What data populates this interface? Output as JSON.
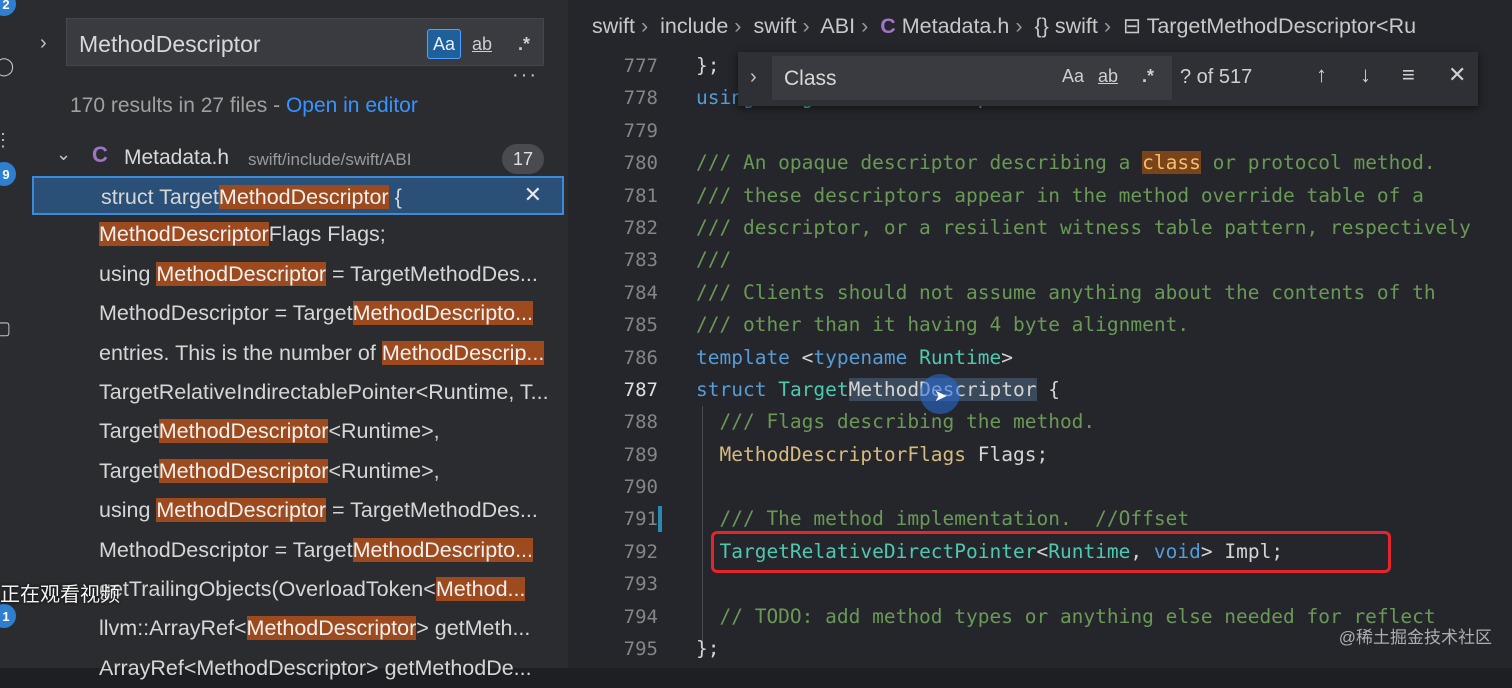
{
  "activity_bar": {
    "badge_top": "2",
    "badge_mid": "9",
    "badge_bottom": "1"
  },
  "search": {
    "query": "MethodDescriptor",
    "opt_case": "Aa",
    "opt_word": "ab",
    "opt_regex": ".*",
    "more": "···",
    "summary_prefix": "170 results in 27 files - ",
    "open_in_editor": "Open in editor",
    "file": {
      "icon": "C",
      "name": "Metadata.h",
      "path": "swift/include/swift/ABI",
      "count": "17"
    },
    "results": [
      {
        "pre": "struct Target",
        "match": "MethodDescriptor",
        "post": " {"
      },
      {
        "pre": "",
        "match": "MethodDescriptor",
        "post": "Flags Flags;"
      },
      {
        "pre": "using ",
        "match": "MethodDescriptor",
        "post": " = TargetMethodDes..."
      },
      {
        "pre": "MethodDescriptor = Target",
        "match": "MethodDescripto...",
        "post": ""
      },
      {
        "pre": "entries. This is the number of ",
        "match": "MethodDescrip...",
        "post": ""
      },
      {
        "pre": "TargetRelativeIndirectablePointer<Runtime, T...",
        "match": "",
        "post": ""
      },
      {
        "pre": "Target",
        "match": "MethodDescriptor",
        "post": "<Runtime>,"
      },
      {
        "pre": "Target",
        "match": "MethodDescriptor",
        "post": "<Runtime>,"
      },
      {
        "pre": "using ",
        "match": "MethodDescriptor",
        "post": " = TargetMethodDes..."
      },
      {
        "pre": "MethodDescriptor = Target",
        "match": "MethodDescripto...",
        "post": ""
      },
      {
        "pre": "getTrailingObjects(OverloadToken<",
        "match": "Method...",
        "post": ""
      },
      {
        "pre": "llvm::ArrayRef<",
        "match": "MethodDescriptor",
        "post": "> getMeth..."
      },
      {
        "pre": "ArrayRef<MethodDescriptor> getMethodDe...",
        "match": "",
        "post": ""
      }
    ]
  },
  "overlay_caption": "正在观看视频",
  "editor": {
    "breadcrumb": [
      "swift",
      "include",
      "swift",
      "ABI",
      "Metadata.h",
      "{} swift",
      "TargetMethodDescriptor<Ru"
    ],
    "find": {
      "query": "Class",
      "opt_case": "Aa",
      "opt_word": "ab",
      "opt_regex": ".*",
      "count": "? of 517"
    },
    "line_numbers": [
      "777",
      "778",
      "779",
      "780",
      "781",
      "782",
      "783",
      "784",
      "785",
      "786",
      "787",
      "788",
      "789",
      "790",
      "791",
      "792",
      "793",
      "794",
      "795"
    ],
    "lines": [
      "};",
      "using TargetMethodDescriptorPointer = ...",
      "",
      "/// An opaque descriptor describing a class or protocol method.",
      "/// these descriptors appear in the method override table of a",
      "/// descriptor, or a resilient witness table pattern, respectively",
      "///",
      "/// Clients should not assume anything about the contents of th",
      "/// other than it having 4 byte alignment.",
      "template <typename Runtime>",
      "struct TargetMethodDescriptor {",
      "  /// Flags describing the method.",
      "  MethodDescriptorFlags Flags;",
      "",
      "  /// The method implementation.  //Offset",
      "  TargetRelativeDirectPointer<Runtime, void> Impl;",
      "",
      "  // TODO: add method types or anything else needed for reflect",
      "};"
    ]
  },
  "watermark": "@稀土掘金技术社区"
}
